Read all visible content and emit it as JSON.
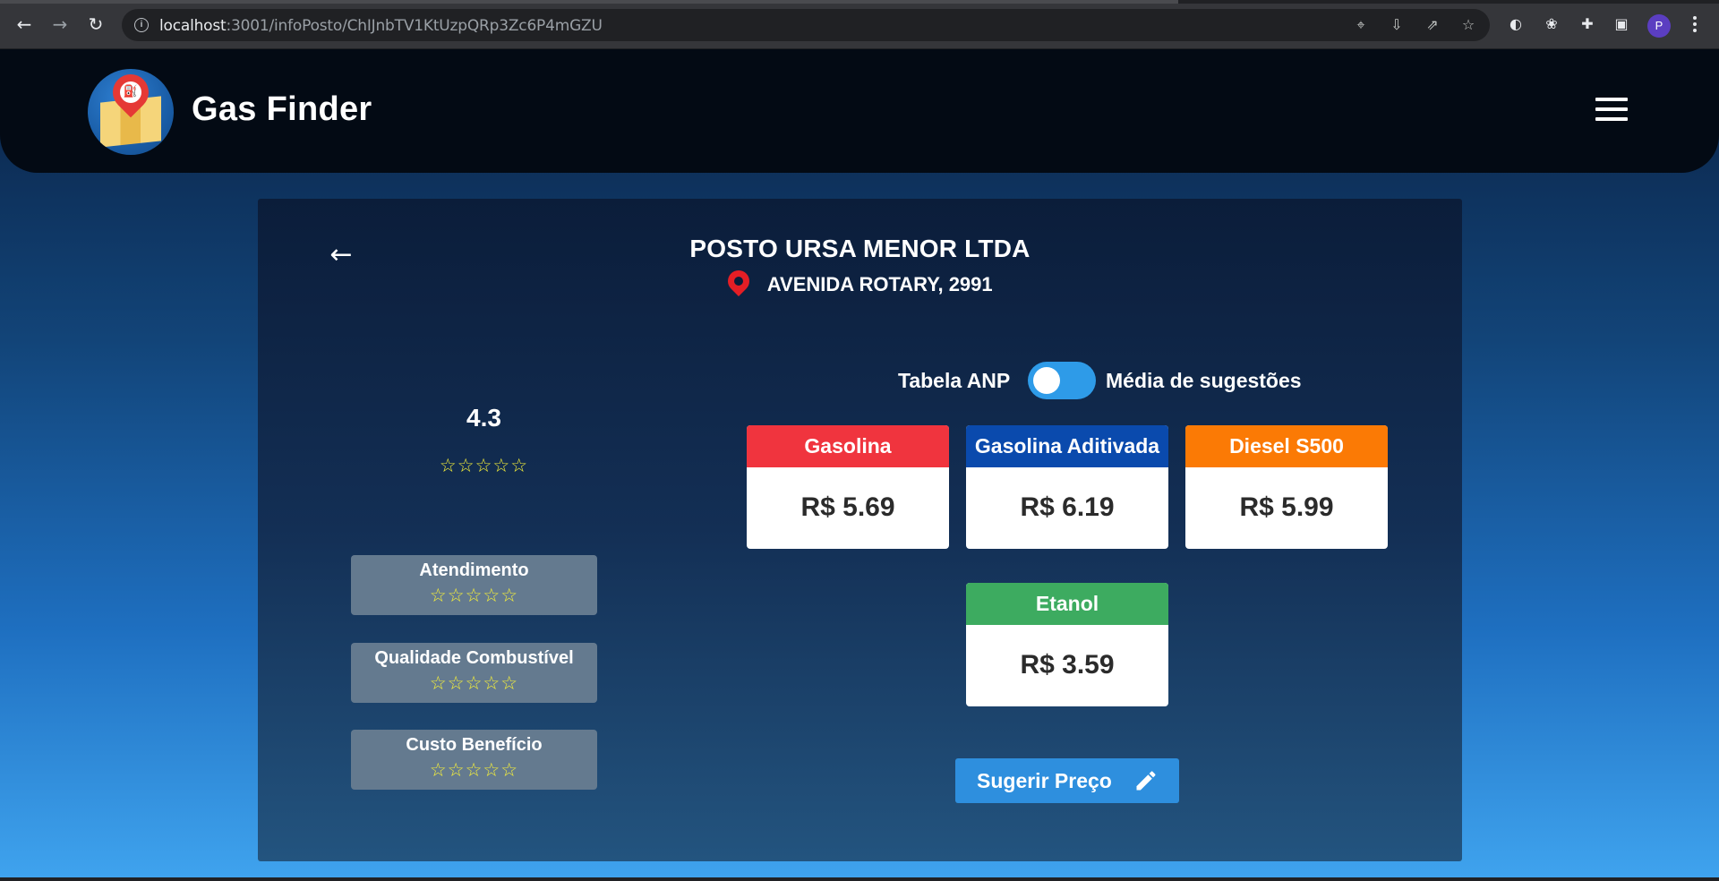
{
  "browser": {
    "url_host": "localhost",
    "url_path": ":3001/infoPosto/ChIJnbTV1KtUzpQRp3Zc6P4mGZU",
    "profile_initial": "P"
  },
  "app": {
    "brand": "Gas Finder"
  },
  "station": {
    "name": "POSTO URSA MENOR LTDA",
    "address": "AVENIDA ROTARY, 2991"
  },
  "ratings": {
    "overall": "4.3",
    "overall_stars": "☆☆☆☆☆",
    "categories": [
      {
        "label": "Atendimento",
        "stars": "☆☆☆☆☆"
      },
      {
        "label": "Qualidade Combustível",
        "stars": "☆☆☆☆☆"
      },
      {
        "label": "Custo Benefício",
        "stars": "☆☆☆☆☆"
      }
    ]
  },
  "price_source_toggle": {
    "left_label": "Tabela ANP",
    "right_label": "Média de sugestões"
  },
  "fuels": [
    {
      "name": "Gasolina",
      "price": "R$ 5.69",
      "color": "#f0343e"
    },
    {
      "name": "Gasolina Aditivada",
      "price": "R$ 6.19",
      "color": "#0a4aad"
    },
    {
      "name": "Diesel S500",
      "price": "R$ 5.99",
      "color": "#fb7a05"
    },
    {
      "name": "Etanol",
      "price": "R$ 3.59",
      "color": "#3dab60"
    }
  ],
  "actions": {
    "suggest_price_label": "Sugerir Preço"
  },
  "colors": {
    "header_bg": "#030a14",
    "accent_blue": "#2e8fde",
    "star_yellow": "#f6f03a",
    "pin_red": "#e51e25"
  }
}
